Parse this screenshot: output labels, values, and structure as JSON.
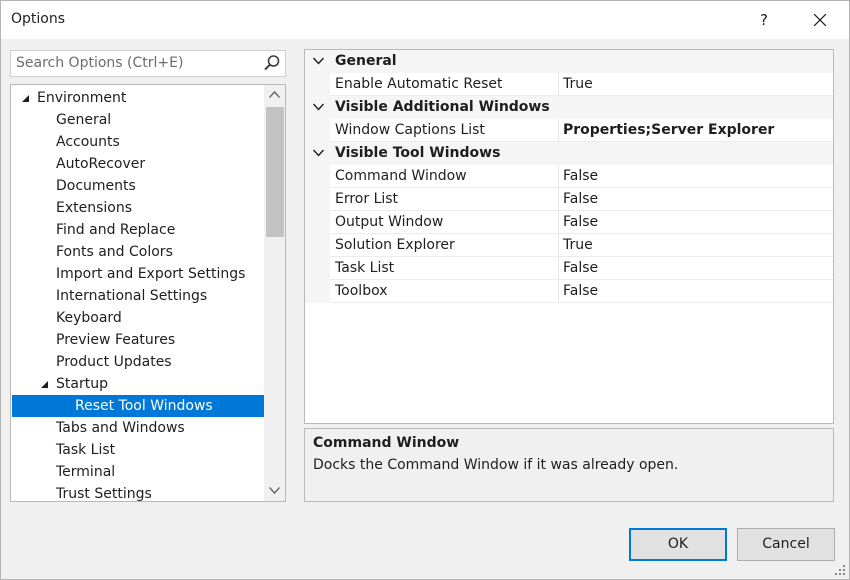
{
  "window": {
    "title": "Options",
    "help_label": "?"
  },
  "search": {
    "placeholder": "Search Options (Ctrl+E)"
  },
  "tree": {
    "items": [
      {
        "label": "Environment",
        "level": 0,
        "expanded": true
      },
      {
        "label": "General",
        "level": 1
      },
      {
        "label": "Accounts",
        "level": 1
      },
      {
        "label": "AutoRecover",
        "level": 1
      },
      {
        "label": "Documents",
        "level": 1
      },
      {
        "label": "Extensions",
        "level": 1
      },
      {
        "label": "Find and Replace",
        "level": 1
      },
      {
        "label": "Fonts and Colors",
        "level": 1
      },
      {
        "label": "Import and Export Settings",
        "level": 1
      },
      {
        "label": "International Settings",
        "level": 1
      },
      {
        "label": "Keyboard",
        "level": 1
      },
      {
        "label": "Preview Features",
        "level": 1
      },
      {
        "label": "Product Updates",
        "level": 1
      },
      {
        "label": "Startup",
        "level": 1,
        "expanded": true
      },
      {
        "label": "Reset Tool Windows",
        "level": 2,
        "selected": true
      },
      {
        "label": "Tabs and Windows",
        "level": 1
      },
      {
        "label": "Task List",
        "level": 1
      },
      {
        "label": "Terminal",
        "level": 1
      },
      {
        "label": "Trust Settings",
        "level": 1
      }
    ]
  },
  "properties": [
    {
      "category": "General"
    },
    {
      "name": "Enable Automatic Reset",
      "value": "True"
    },
    {
      "category": "Visible Additional Windows"
    },
    {
      "name": "Window Captions List",
      "value": "Properties;Server Explorer",
      "bold": true
    },
    {
      "category": "Visible Tool Windows"
    },
    {
      "name": "Command Window",
      "value": "False"
    },
    {
      "name": "Error List",
      "value": "False"
    },
    {
      "name": "Output Window",
      "value": "False"
    },
    {
      "name": "Solution Explorer",
      "value": "True"
    },
    {
      "name": "Task List",
      "value": "False"
    },
    {
      "name": "Toolbox",
      "value": "False"
    }
  ],
  "description": {
    "title": "Command Window",
    "text": "Docks the Command Window if it was already open."
  },
  "buttons": {
    "ok": "OK",
    "cancel": "Cancel"
  },
  "colors": {
    "selection": "#0078d7",
    "accent_border": "#0078d7"
  },
  "icons": {
    "search": "search-icon",
    "close": "close-icon",
    "expand": "expanded-triangle-icon",
    "collapse": "chevron-down-icon"
  }
}
